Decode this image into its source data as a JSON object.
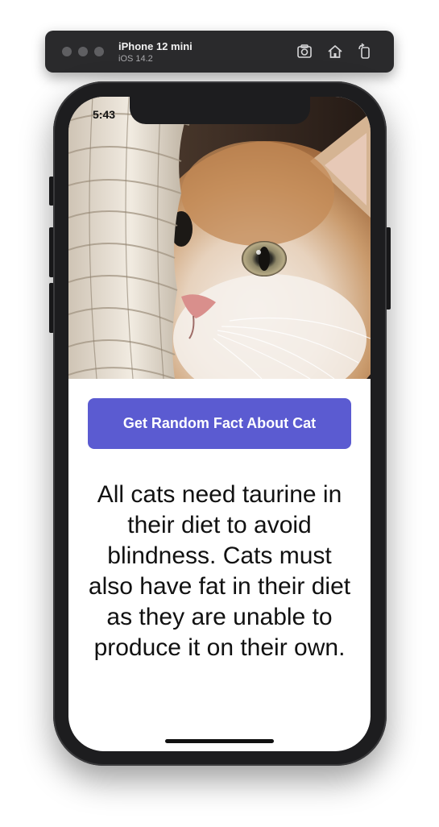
{
  "simulator": {
    "device_name": "iPhone 12 mini",
    "os_version": "iOS 14.2",
    "icons": [
      "screenshot-icon",
      "home-icon",
      "rotate-icon"
    ]
  },
  "status_bar": {
    "time": "5:43"
  },
  "app": {
    "image": {
      "subject": "kitten peeking from behind wicker basket"
    },
    "button_label": "Get Random Fact About Cat",
    "fact": "All cats need taurine in their diet to avoid blindness. Cats must also have fat in their diet as they are unable to produce it on their own.",
    "colors": {
      "button": "#5b5bd1",
      "button_text": "#ffffff",
      "text": "#111111"
    }
  }
}
